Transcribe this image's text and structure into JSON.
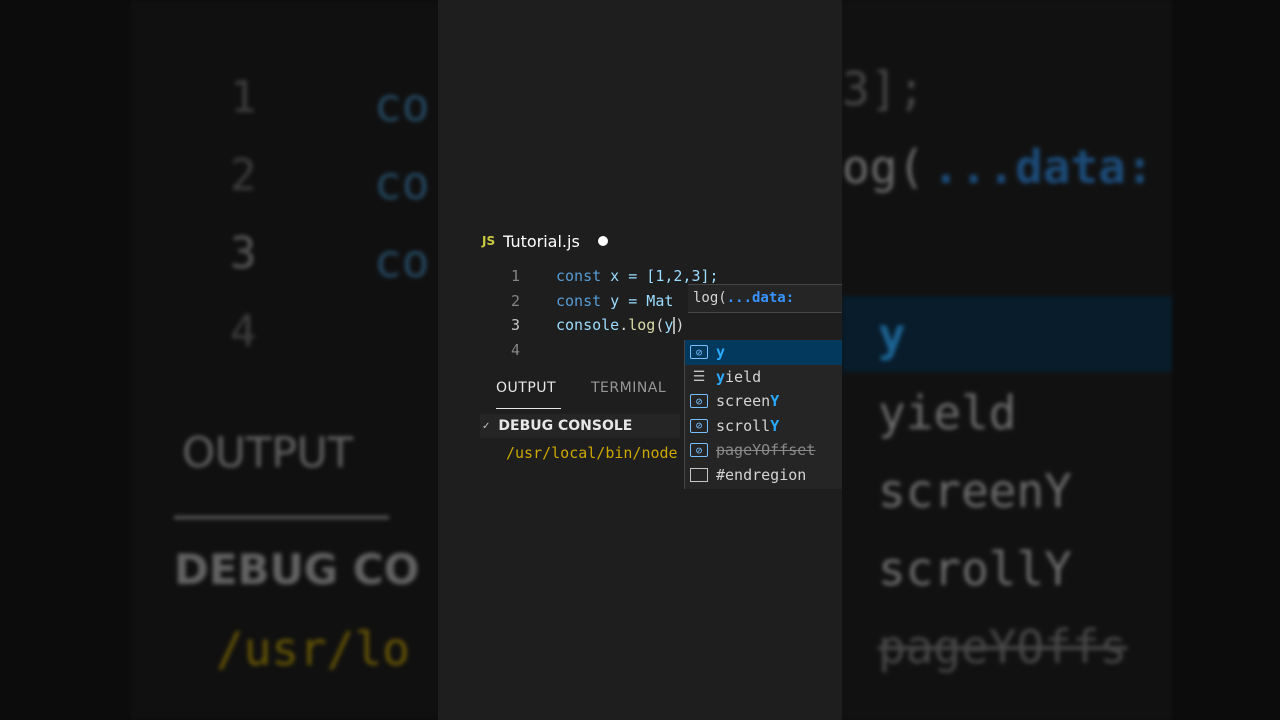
{
  "editor": {
    "tab_icon": "JS",
    "tab_name": "Tutorial.js",
    "lines": [
      {
        "num": "1",
        "kw": "const",
        "rest": " x = [1,2,3];"
      },
      {
        "num": "2",
        "kw": "const",
        "rest": " y = Mat"
      },
      {
        "num": "3",
        "obj": "console",
        "dot": ".",
        "fn": "log",
        "open": "(",
        "arg": "y",
        "close": ")"
      },
      {
        "num": "4"
      }
    ]
  },
  "hover": {
    "prefix": "log(",
    "param": "...data:"
  },
  "suggest": {
    "items": [
      {
        "icon": "variable-icon",
        "match": "y",
        "rest": ""
      },
      {
        "icon": "keyword-icon",
        "match": "y",
        "rest": "ield"
      },
      {
        "icon": "variable-icon",
        "pre": "screen",
        "match": "Y"
      },
      {
        "icon": "variable-icon",
        "pre": "scroll",
        "match": "Y"
      },
      {
        "icon": "variable-icon",
        "deprecated": "pageYOffset"
      },
      {
        "icon": "snippet-icon",
        "label": "#endregion"
      }
    ]
  },
  "panel": {
    "tabs": [
      "OUTPUT",
      "TERMINAL"
    ],
    "section": "DEBUG CONSOLE",
    "output_line": "/usr/local/bin/node"
  },
  "background": {
    "left_lines": [
      "1",
      "2",
      "3",
      "4"
    ],
    "left_code": "co",
    "left_output": "OUTPUT",
    "left_debug": "DEBUG CO",
    "left_path": "/usr/lo",
    "right_top": "3];",
    "right_log": "og(",
    "right_data": "...data:",
    "right_items": [
      "y",
      "yield",
      "screenY",
      "scrollY",
      "pageYOffs"
    ]
  },
  "colors": {
    "editor_bg": "#1e1e1e",
    "selection": "#04395e",
    "accent": "#2aaaff",
    "output_text": "#cca700"
  }
}
